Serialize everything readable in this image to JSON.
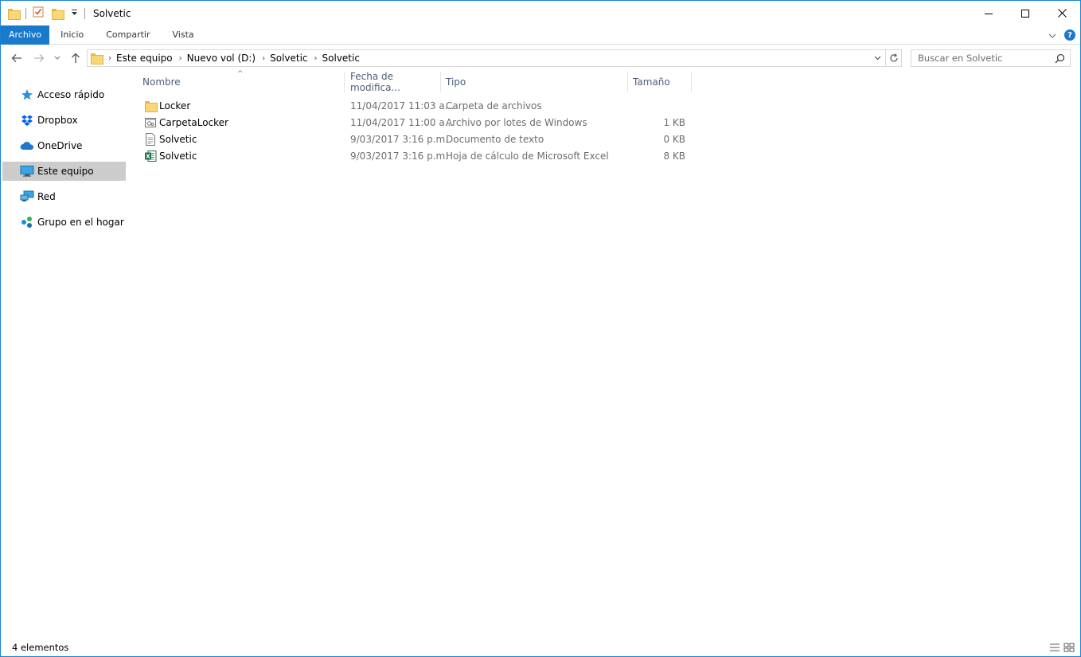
{
  "window": {
    "title": "Solvetic"
  },
  "ribbon": {
    "tabs": [
      {
        "label": "Archivo"
      },
      {
        "label": "Inicio"
      },
      {
        "label": "Compartir"
      },
      {
        "label": "Vista"
      }
    ],
    "help_label": "?"
  },
  "address": {
    "crumbs": [
      "Este equipo",
      "Nuevo vol (D:)",
      "Solvetic",
      "Solvetic"
    ]
  },
  "search": {
    "placeholder": "Buscar en Solvetic"
  },
  "sidebar": {
    "items": [
      {
        "label": "Acceso rápido",
        "icon": "star-icon"
      },
      {
        "label": "Dropbox",
        "icon": "dropbox-icon"
      },
      {
        "label": "OneDrive",
        "icon": "cloud-icon"
      },
      {
        "label": "Este equipo",
        "icon": "computer-icon",
        "selected": true
      },
      {
        "label": "Red",
        "icon": "network-icon"
      },
      {
        "label": "Grupo en el hogar",
        "icon": "homegroup-icon"
      }
    ]
  },
  "columns": {
    "name": "Nombre",
    "date": "Fecha de modifica...",
    "type": "Tipo",
    "size": "Tamaño"
  },
  "files": [
    {
      "name": "Locker",
      "date": "11/04/2017 11:03 a...",
      "type": "Carpeta de archivos",
      "size": "",
      "icon": "folder-icon"
    },
    {
      "name": "CarpetaLocker",
      "date": "11/04/2017 11:00 a...",
      "type": "Archivo por lotes de Windows",
      "size": "1 KB",
      "icon": "batch-file-icon"
    },
    {
      "name": "Solvetic",
      "date": "9/03/2017 3:16 p.m.",
      "type": "Documento de texto",
      "size": "0 KB",
      "icon": "text-file-icon"
    },
    {
      "name": "Solvetic",
      "date": "9/03/2017 3:16 p.m.",
      "type": "Hoja de cálculo de Microsoft Excel",
      "size": "8 KB",
      "icon": "excel-file-icon"
    }
  ],
  "status": {
    "count": "4 elementos"
  },
  "colors": {
    "accent": "#1979ca",
    "selected_bg": "#cccccc",
    "header_text": "#4c607a"
  }
}
